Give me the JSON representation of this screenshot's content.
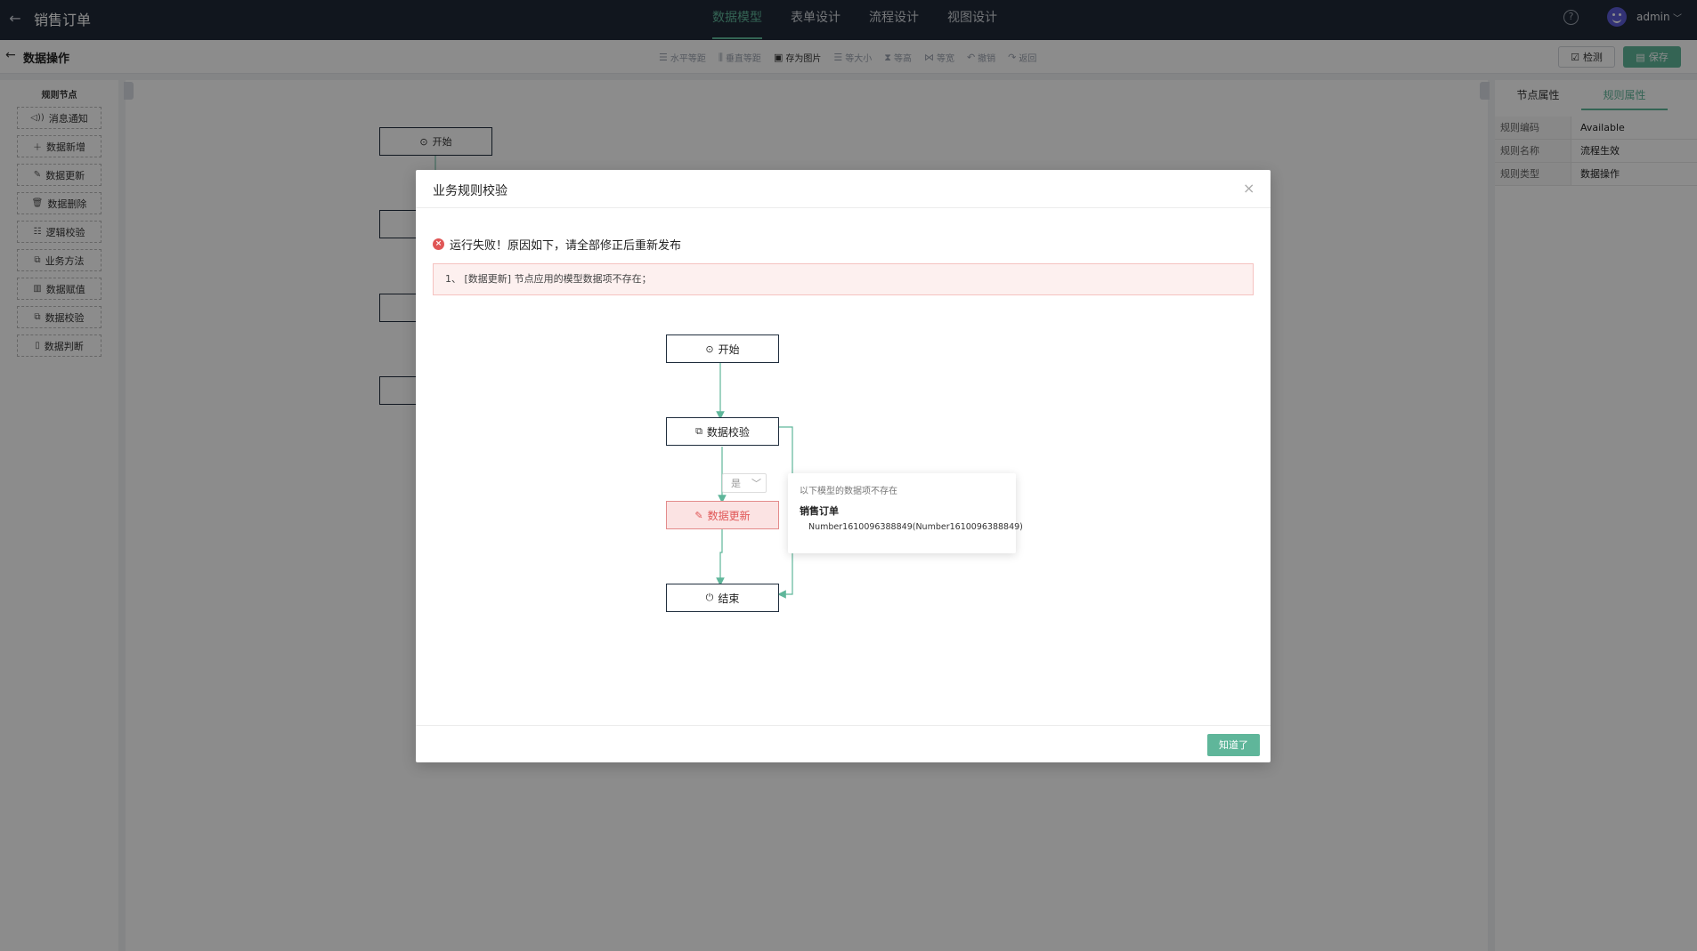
{
  "topbar": {
    "title": "销售订单",
    "tabs": [
      "数据模型",
      "表单设计",
      "流程设计",
      "视图设计"
    ],
    "active_tab": "数据模型",
    "help_glyph": "?",
    "user": "admin"
  },
  "subbar": {
    "title": "数据操作",
    "tools": [
      {
        "label": "水平等距",
        "icon": "horizontal-distribute-icon",
        "enabled": false
      },
      {
        "label": "垂直等距",
        "icon": "vertical-distribute-icon",
        "enabled": false
      },
      {
        "label": "存为图片",
        "icon": "image-icon",
        "enabled": true
      },
      {
        "label": "等大小",
        "icon": "same-size-icon",
        "enabled": false
      },
      {
        "label": "等高",
        "icon": "same-height-icon",
        "enabled": false
      },
      {
        "label": "等宽",
        "icon": "same-width-icon",
        "enabled": false
      },
      {
        "label": "撤销",
        "icon": "undo-icon",
        "enabled": false
      },
      {
        "label": "返回",
        "icon": "redo-icon",
        "enabled": false
      }
    ],
    "check_label": "检测",
    "save_label": "保存"
  },
  "left_panel": {
    "title": "规则节点",
    "items": [
      {
        "label": "消息通知",
        "icon": "notification-icon"
      },
      {
        "label": "数据新增",
        "icon": "plus-icon"
      },
      {
        "label": "数据更新",
        "icon": "edit-icon"
      },
      {
        "label": "数据删除",
        "icon": "trash-icon"
      },
      {
        "label": "逻辑校验",
        "icon": "logic-icon"
      },
      {
        "label": "业务方法",
        "icon": "method-icon"
      },
      {
        "label": "数据赋值",
        "icon": "assign-icon"
      },
      {
        "label": "数据校验",
        "icon": "copy-check-icon"
      },
      {
        "label": "数据判断",
        "icon": "judge-icon"
      }
    ]
  },
  "canvas": {
    "start_label": "开始"
  },
  "right_panel": {
    "tabs": [
      "节点属性",
      "规则属性"
    ],
    "active_tab": "规则属性",
    "props": [
      {
        "key": "规则编码",
        "value": "Available"
      },
      {
        "key": "规则名称",
        "value": "流程生效"
      },
      {
        "key": "规则类型",
        "value": "数据操作"
      }
    ]
  },
  "modal": {
    "title": "业务规则校验",
    "close_glyph": "×",
    "error_summary": "运行失败！原因如下，请全部修正后重新发布",
    "error_detail": "1、 [数据更新] 节点应用的模型数据项不存在；",
    "flow": {
      "start": "开始",
      "check": "数据校验",
      "yes": "是",
      "update": "数据更新",
      "end": "结束"
    },
    "tooltip": {
      "heading": "以下模型的数据项不存在",
      "model": "销售订单",
      "item": "Number1610096388849(Number1610096388849)"
    },
    "ok_label": "知道了"
  },
  "colors": {
    "accent": "#5fb69a",
    "topbar": "#1f2937",
    "error": "#e05656"
  }
}
